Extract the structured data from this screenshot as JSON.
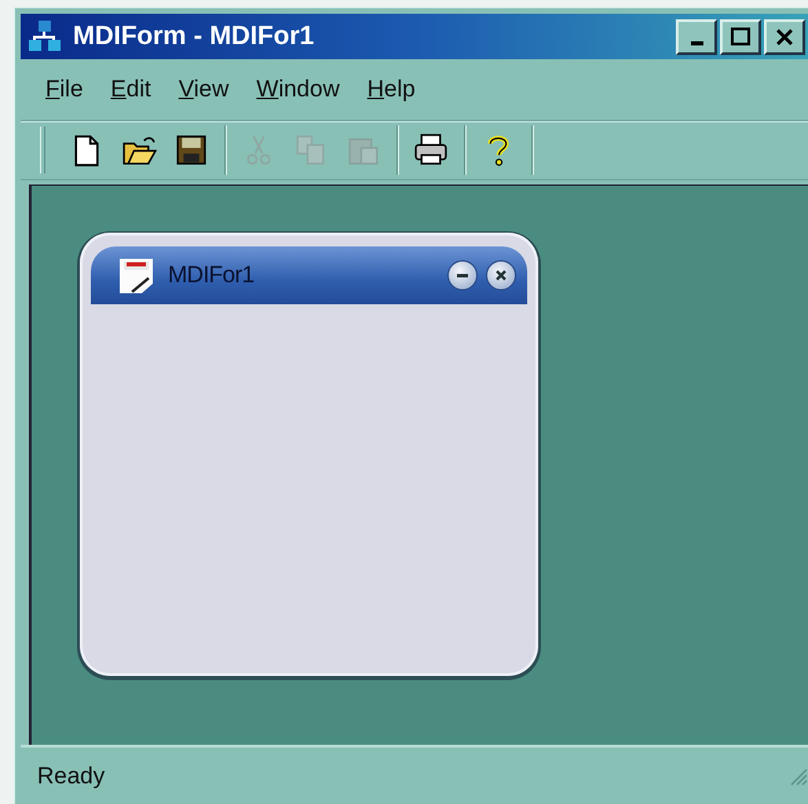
{
  "window": {
    "title": "MDIForm - MDIFor1"
  },
  "menu": [
    {
      "label": "File"
    },
    {
      "label": "Edit"
    },
    {
      "label": "View"
    },
    {
      "label": "Window"
    },
    {
      "label": "Help"
    }
  ],
  "toolbar": {
    "groups": [
      {
        "buttons": [
          {
            "disabled": false
          },
          {
            "disabled": false
          },
          {
            "disabled": false
          }
        ]
      },
      {
        "buttons": [
          {
            "disabled": true
          },
          {
            "disabled": true
          },
          {
            "disabled": true
          }
        ]
      },
      {
        "buttons": [
          {
            "disabled": false
          }
        ]
      },
      {
        "buttons": [
          {
            "disabled": false
          }
        ]
      }
    ]
  },
  "child_window": {
    "title": "MDIFor1"
  },
  "status_bar": {
    "text": "Ready"
  }
}
